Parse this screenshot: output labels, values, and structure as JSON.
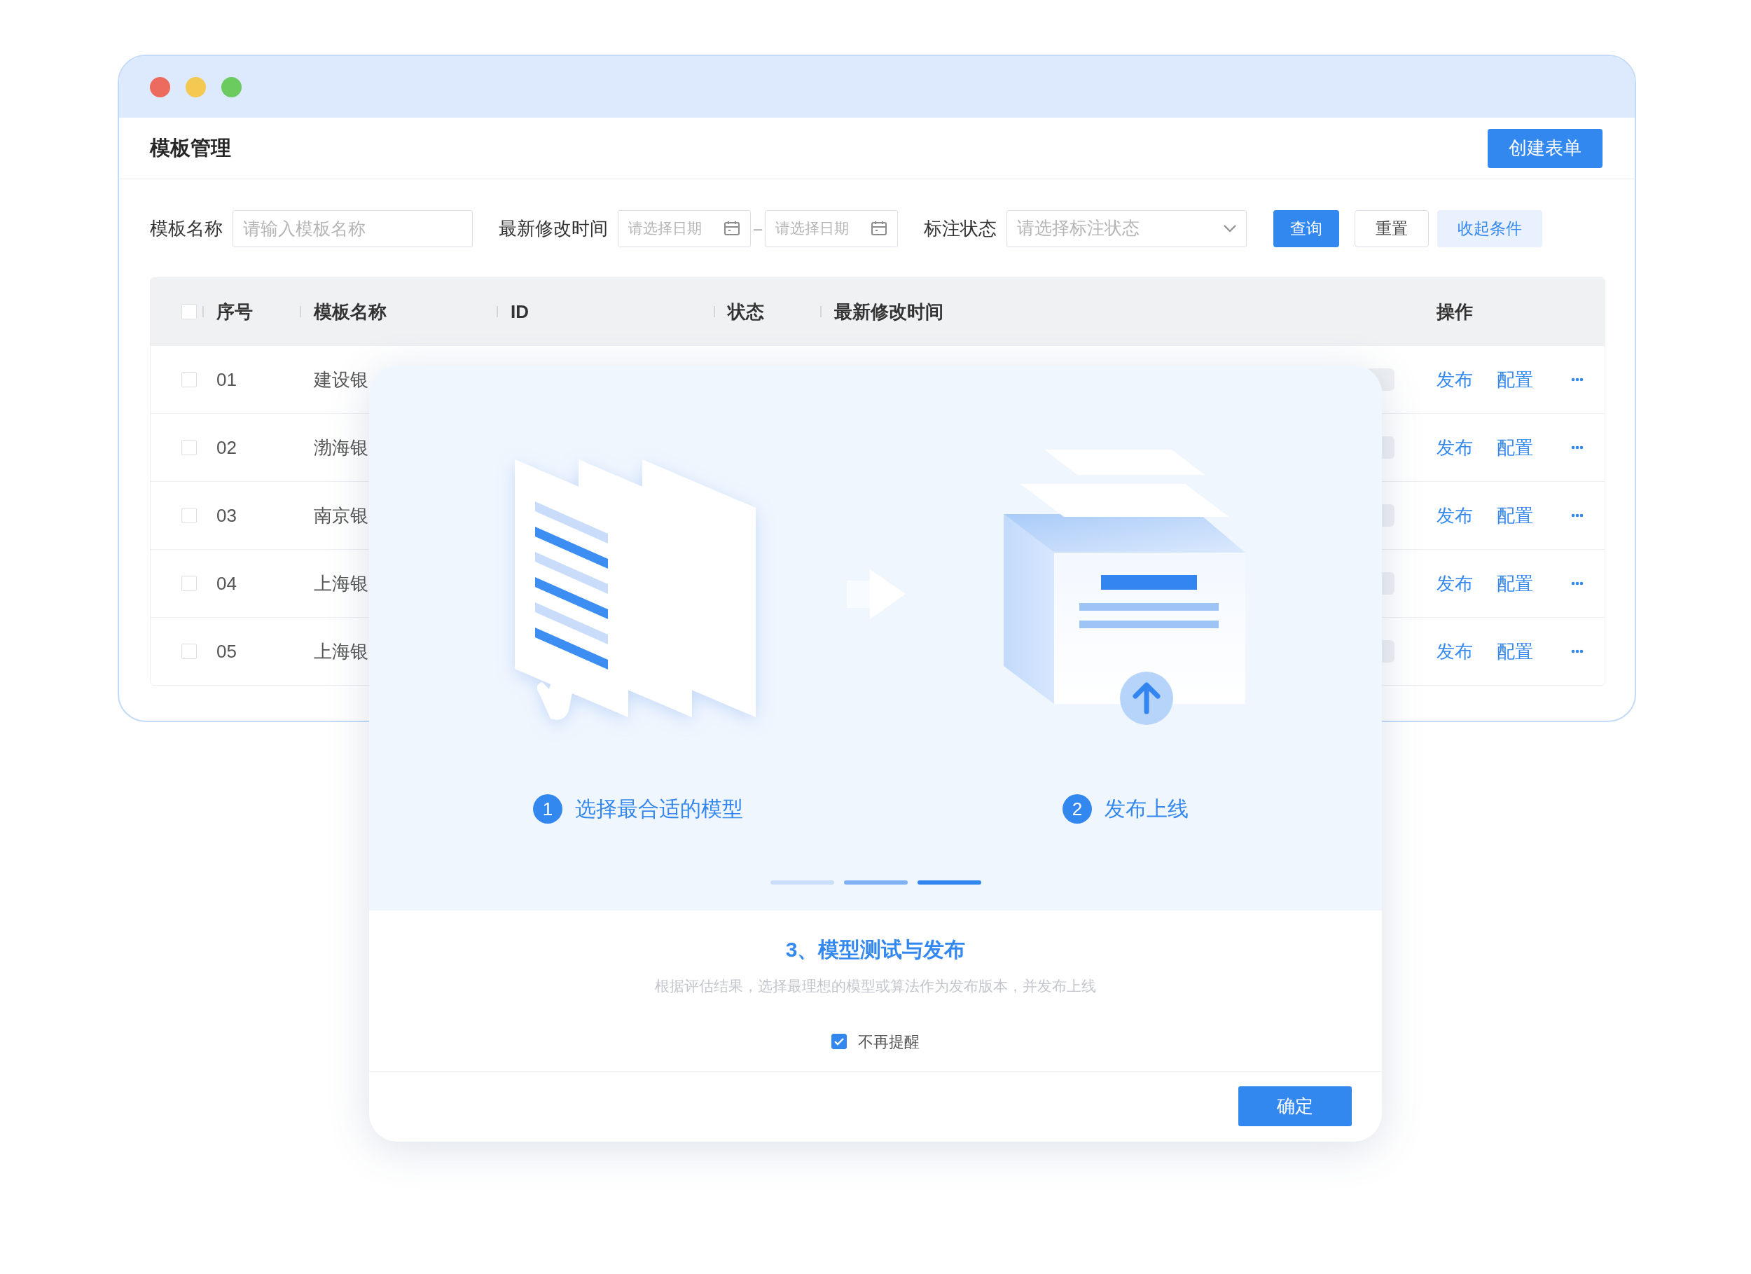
{
  "header": {
    "title": "模板管理",
    "create_button": "创建表单"
  },
  "filters": [
    {
      "kind": "text",
      "label": "模板名称",
      "placeholder": "请输入模板名称"
    },
    {
      "kind": "date_range",
      "label": "最新修改时间",
      "placeholders": [
        "请选择日期",
        "请选择日期"
      ],
      "separator": "–"
    },
    {
      "kind": "select",
      "label": "标注状态",
      "placeholder": "请选择标注状态"
    }
  ],
  "filter_buttons": [
    {
      "kind": "primary",
      "label": "查询"
    },
    {
      "kind": "default",
      "label": "重置"
    },
    {
      "kind": "light",
      "label": "收起条件"
    }
  ],
  "table": {
    "header_checked": false,
    "columns": [
      "序号",
      "模板名称",
      "ID",
      "状态",
      "最新修改时间",
      "操作"
    ],
    "rows": [
      {
        "checked": false,
        "index": "01",
        "name": "建设银",
        "actions": [
          "发布",
          "配置"
        ]
      },
      {
        "checked": false,
        "index": "02",
        "name": "渤海银",
        "actions": [
          "发布",
          "配置"
        ]
      },
      {
        "checked": false,
        "index": "03",
        "name": "南京银",
        "actions": [
          "发布",
          "配置"
        ]
      },
      {
        "checked": false,
        "index": "04",
        "name": "上海银",
        "actions": [
          "发布",
          "配置"
        ]
      },
      {
        "checked": false,
        "index": "05",
        "name": "上海银",
        "actions": [
          "发布",
          "配置"
        ]
      }
    ]
  },
  "modal": {
    "steps": [
      {
        "number": "1",
        "label": "选择最合适的模型"
      },
      {
        "number": "2",
        "label": "发布上线"
      }
    ],
    "pager": [
      {
        "color": "#c9defa"
      },
      {
        "color": "#7fb2f3"
      },
      {
        "color": "#3385f0"
      }
    ],
    "title": "3、模型测试与发布",
    "description": "根据评估结果，选择最理想的模型或算法作为发布版本，并发布上线",
    "dont_remind": {
      "label": "不再提醒",
      "checked": true
    },
    "confirm": "确定"
  }
}
